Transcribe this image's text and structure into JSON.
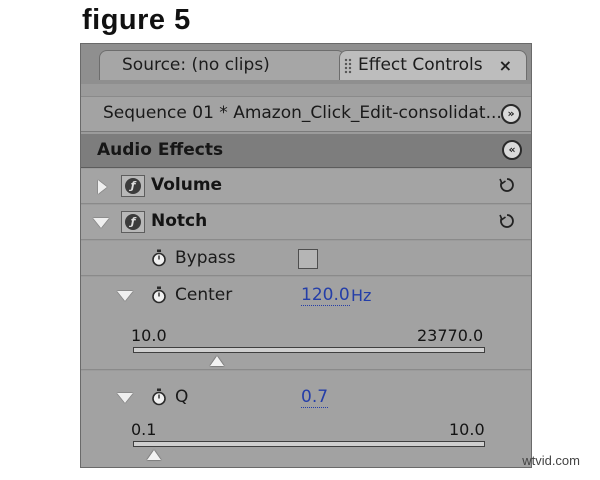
{
  "figure_caption": "figure 5",
  "tabs": [
    {
      "label": "Source: (no clips)",
      "active": false
    },
    {
      "label": "Effect Controls",
      "active": true,
      "close_glyph": "×"
    }
  ],
  "sequence": {
    "title": "Sequence 01 * Amazon_Click_Edit-consolidat...",
    "nav_icon": "show-timeline-icon",
    "nav_glyph": "»"
  },
  "section": {
    "title": "Audio Effects",
    "collapse_icon": "collapse-icon",
    "collapse_glyph": "«"
  },
  "effects": [
    {
      "name": "Volume",
      "expanded": false,
      "fx_glyph": "ƒ"
    },
    {
      "name": "Notch",
      "expanded": true,
      "fx_glyph": "ƒ"
    }
  ],
  "params": {
    "bypass": {
      "label": "Bypass",
      "checked": false
    },
    "center": {
      "label": "Center",
      "value": "120.0",
      "unit": "Hz",
      "min_label": "10.0",
      "max_label": "23770.0",
      "min": 10.0,
      "max": 23770.0,
      "current": 120.0,
      "thumb_fraction": 0.24
    },
    "q": {
      "label": "Q",
      "value": "0.7",
      "min_label": "0.1",
      "max_label": "10.0",
      "min": 0.1,
      "max": 10.0,
      "current": 0.7,
      "thumb_fraction": 0.06
    }
  },
  "colors": {
    "panel_bg": "#9b9b9b",
    "header_bg": "#7d7d7d",
    "value_link": "#243ea8"
  },
  "watermark": "wtvid.com"
}
